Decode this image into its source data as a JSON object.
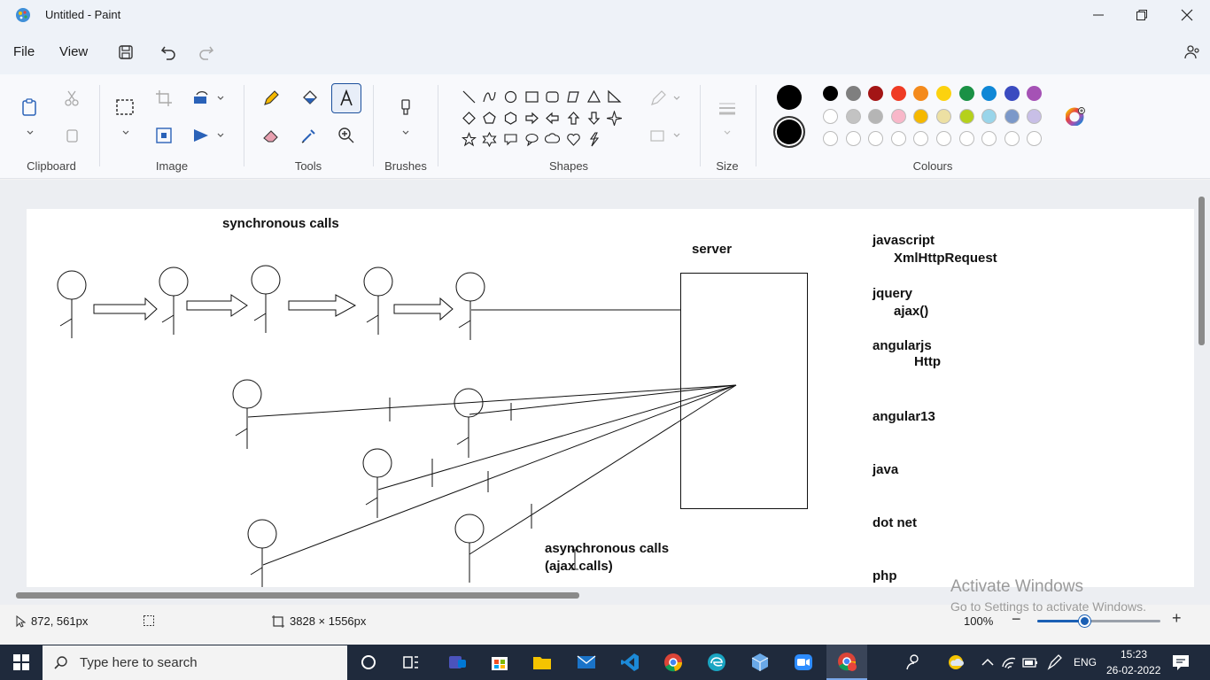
{
  "window": {
    "title": "Untitled - Paint"
  },
  "menu": {
    "file": "File",
    "view": "View"
  },
  "ribbon": {
    "groups": {
      "clipboard": "Clipboard",
      "image": "Image",
      "tools": "Tools",
      "brushes": "Brushes",
      "shapes": "Shapes",
      "size": "Size",
      "colours": "Colours"
    },
    "active_tool": "text-tool"
  },
  "palette": {
    "colour1": "#000000",
    "colour2": "#000000",
    "row1": [
      "#000000",
      "#7f7f7f",
      "#a31515",
      "#ef3b24",
      "#f48a1c",
      "#fcd20f",
      "#1a9145",
      "#0f87d6",
      "#3a4bc0",
      "#a552b5"
    ],
    "row2": [
      "#ffffff",
      "#c3c3c3",
      "#b5b5b5",
      "#f8b7c9",
      "#f5b800",
      "#ede0a3",
      "#b5d11c",
      "#99d5ea",
      "#7b98c9",
      "#c8bfe7"
    ],
    "row3_count": 10
  },
  "canvas": {
    "texts": {
      "sync_title": "synchronous calls",
      "server": "server",
      "async_title": "asynchronous calls",
      "async_sub": "(ajax calls)",
      "javascript": "javascript",
      "xmlhttp": "XmlHttpRequest",
      "jquery": "jquery",
      "ajax": "ajax()",
      "angularjs": "angularjs",
      "http": "Http",
      "angular13": "angular13",
      "java": "java",
      "dotnet": "dot net",
      "php": "php"
    }
  },
  "status": {
    "cursor_pos": "872, 561px",
    "canvas_size": "3828 × 1556px",
    "zoom": "100%",
    "zoom_fraction": 0.38
  },
  "activation": {
    "line1": "Activate Windows",
    "line2": "Go to Settings to activate Windows."
  },
  "taskbar": {
    "search_placeholder": "Type here to search",
    "lang": "ENG",
    "time": "15:23",
    "date": "26-02-2022"
  }
}
